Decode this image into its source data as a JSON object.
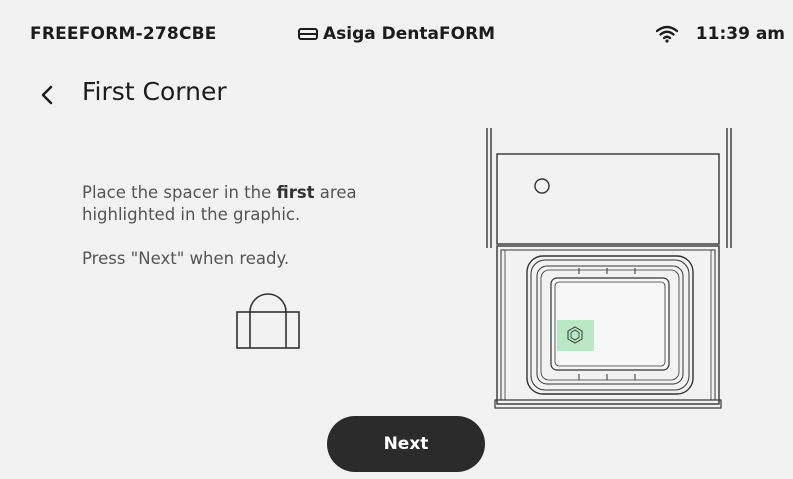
{
  "status_bar": {
    "device_id": "FREEFORM-278CBE",
    "printer_name": "Asiga DentaFORM",
    "time": "11:39 am"
  },
  "header": {
    "title": "First Corner"
  },
  "instructions": {
    "line1_pre": "Place the spacer in the ",
    "line1_bold": "first",
    "line1_post": " area highlighted in the graphic.",
    "line2": "Press \"Next\" when ready."
  },
  "actions": {
    "next_label": "Next"
  },
  "colors": {
    "background": "#f2f2f2",
    "button": "#2b2b2b",
    "highlight": "#b9e8c4"
  }
}
